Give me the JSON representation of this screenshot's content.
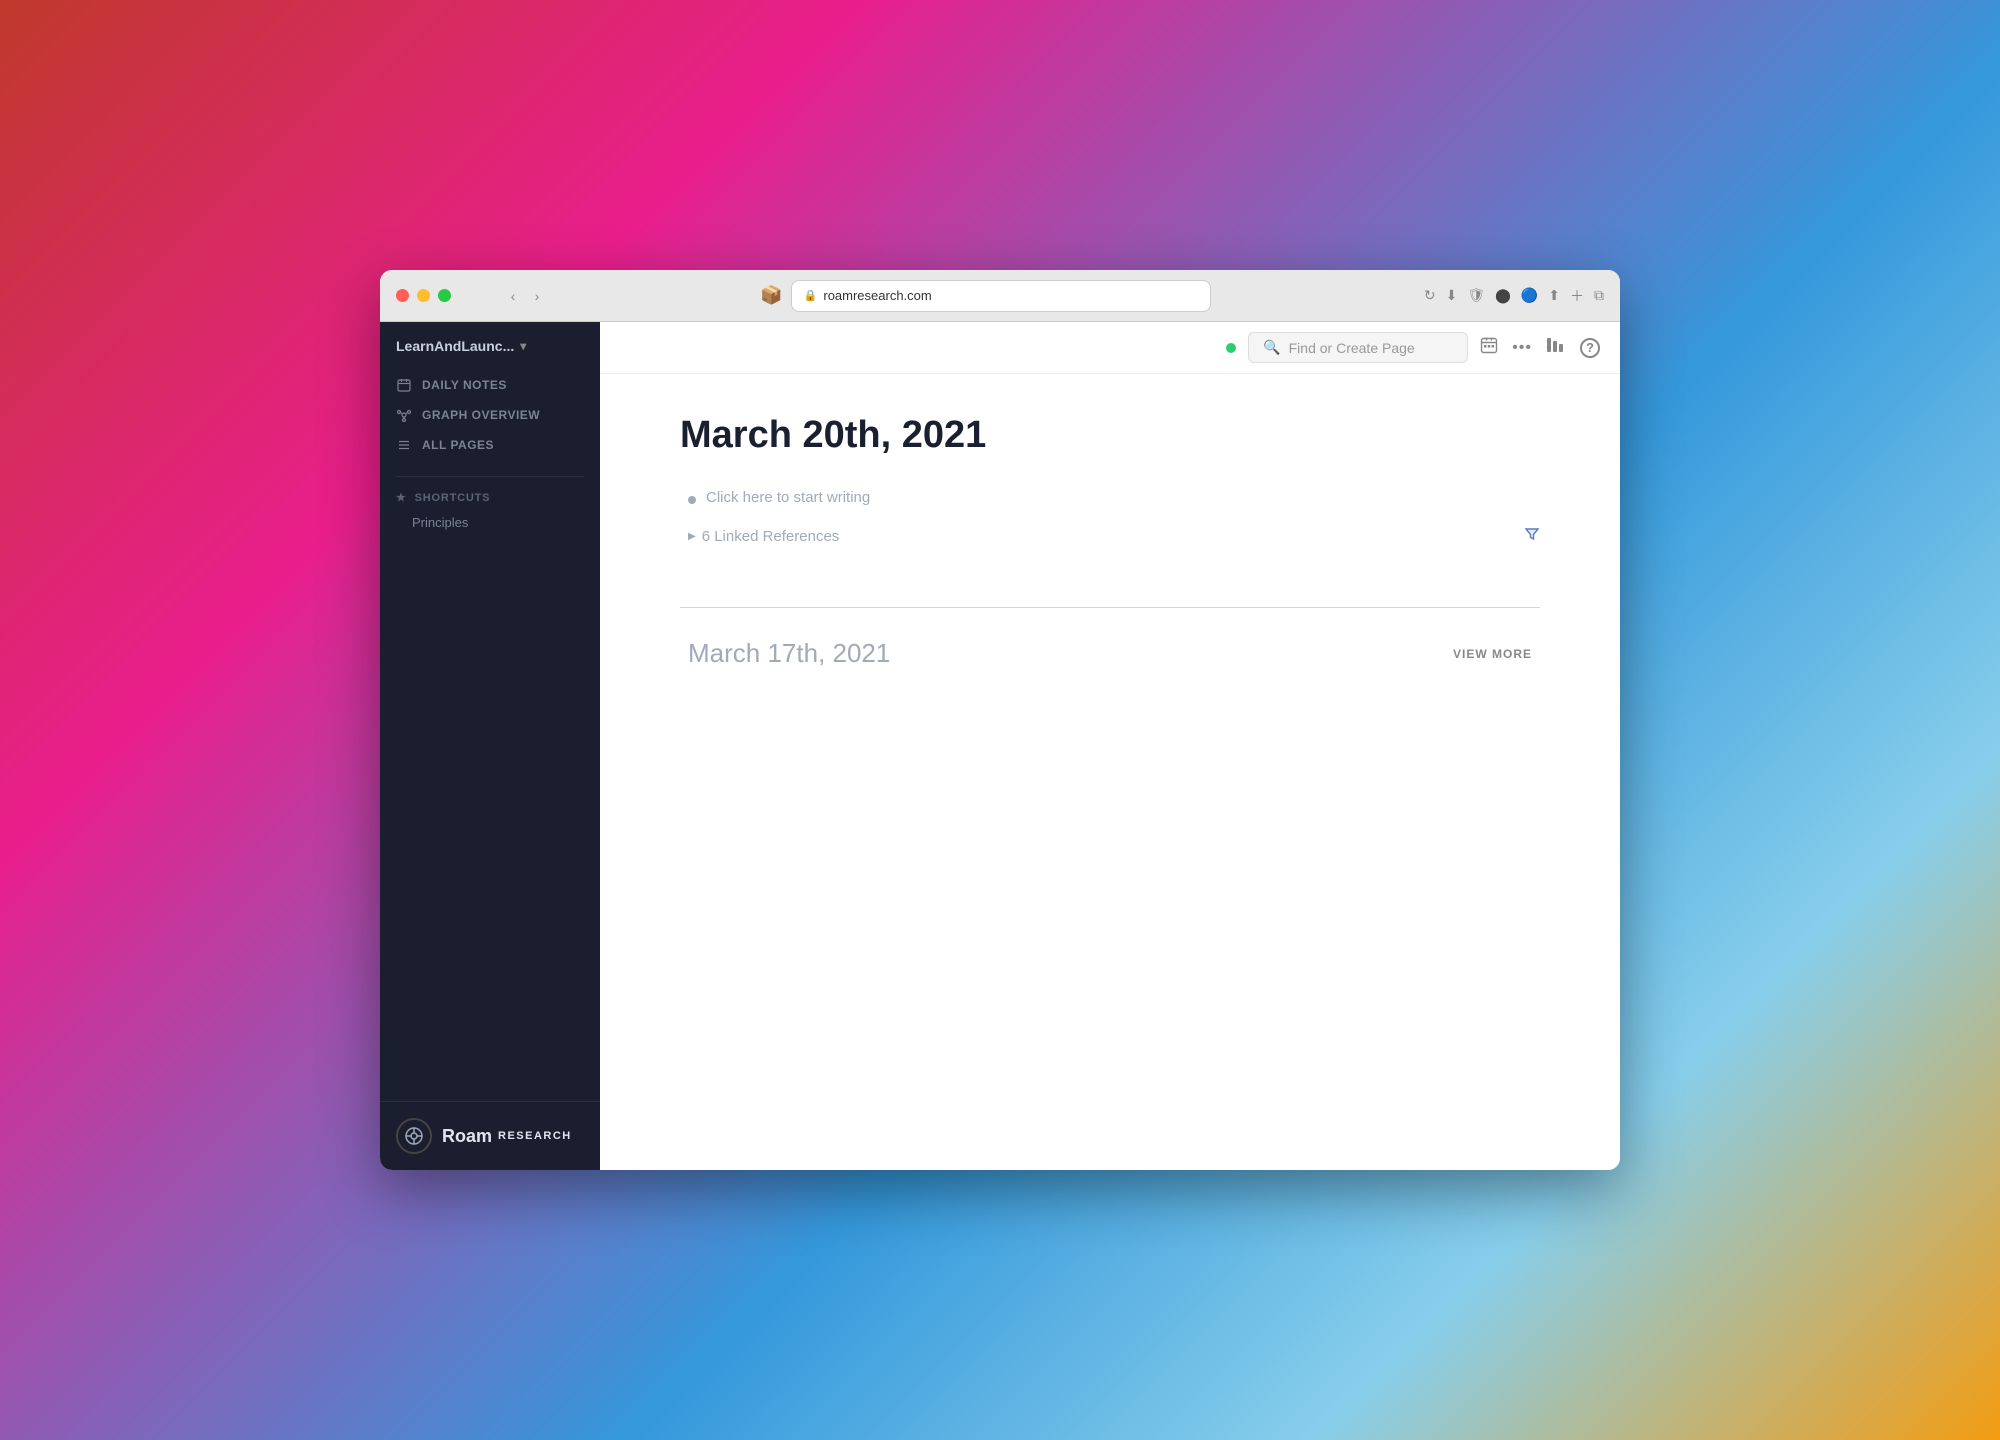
{
  "browser": {
    "url": "roamresearch.com",
    "favicon_alt": "roam-favicon"
  },
  "sidebar": {
    "workspace_name": "LearnAndLaunc...",
    "nav_items": [
      {
        "id": "daily-notes",
        "label": "DAILY NOTES",
        "icon": "calendar"
      },
      {
        "id": "graph-overview",
        "label": "GRAPH OVERVIEW",
        "icon": "graph"
      },
      {
        "id": "all-pages",
        "label": "ALL PAGES",
        "icon": "list"
      }
    ],
    "shortcuts_label": "SHORTCUTS",
    "shortcuts": [
      {
        "id": "principles",
        "label": "Principles"
      }
    ],
    "logo_roam": "Roam",
    "logo_research": "RESEARCH"
  },
  "topbar": {
    "search_placeholder": "Find or Create Page",
    "status_color": "#2ecc71"
  },
  "page": {
    "title": "March 20th, 2021",
    "start_writing_placeholder": "Click here to start writing",
    "linked_references_label": "6 Linked References",
    "filter_icon_alt": "filter-icon"
  },
  "footer": {
    "next_page_title": "March 17th, 2021",
    "view_more_label": "VIEW MORE"
  }
}
